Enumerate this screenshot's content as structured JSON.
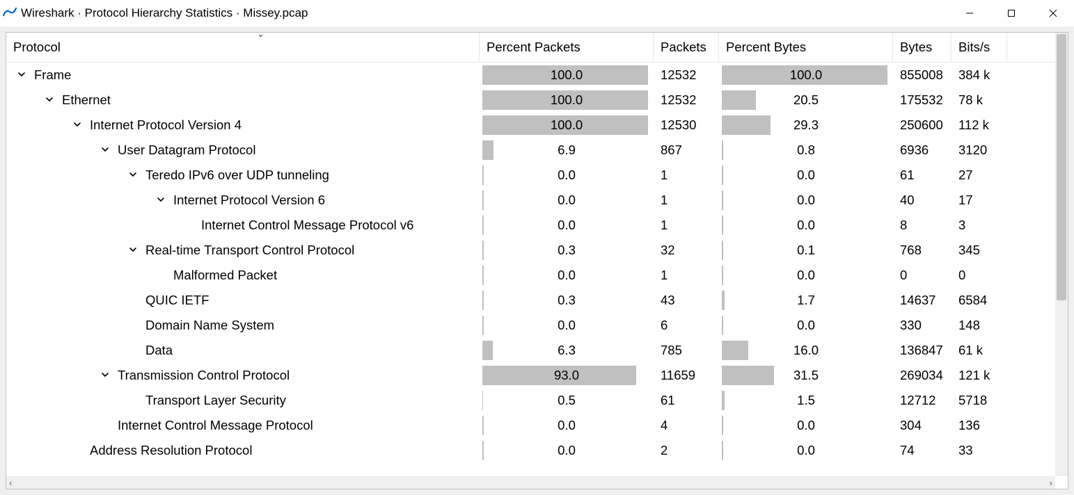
{
  "window": {
    "title": "Wireshark · Protocol Hierarchy Statistics · Missey.pcap"
  },
  "columns": {
    "protocol": "Protocol",
    "pct_packets": "Percent Packets",
    "packets": "Packets",
    "pct_bytes": "Percent Bytes",
    "bytes": "Bytes",
    "bits": "Bits/s"
  },
  "rows": [
    {
      "depth": 0,
      "expanded": true,
      "name": "Frame",
      "pct_packets": 100.0,
      "packets": "12532",
      "pct_bytes": 100.0,
      "bytes": "855008",
      "bits": "384 k"
    },
    {
      "depth": 1,
      "expanded": true,
      "name": "Ethernet",
      "pct_packets": 100.0,
      "packets": "12532",
      "pct_bytes": 20.5,
      "bytes": "175532",
      "bits": "78 k"
    },
    {
      "depth": 2,
      "expanded": true,
      "name": "Internet Protocol Version 4",
      "pct_packets": 100.0,
      "packets": "12530",
      "pct_bytes": 29.3,
      "bytes": "250600",
      "bits": "112 k"
    },
    {
      "depth": 3,
      "expanded": true,
      "name": "User Datagram Protocol",
      "pct_packets": 6.9,
      "packets": "867",
      "pct_bytes": 0.8,
      "bytes": "6936",
      "bits": "3120"
    },
    {
      "depth": 4,
      "expanded": true,
      "name": "Teredo IPv6 over UDP tunneling",
      "pct_packets": 0.0,
      "packets": "1",
      "pct_bytes": 0.0,
      "bytes": "61",
      "bits": "27"
    },
    {
      "depth": 5,
      "expanded": true,
      "name": "Internet Protocol Version 6",
      "pct_packets": 0.0,
      "packets": "1",
      "pct_bytes": 0.0,
      "bytes": "40",
      "bits": "17"
    },
    {
      "depth": 6,
      "expanded": null,
      "name": "Internet Control Message Protocol v6",
      "pct_packets": 0.0,
      "packets": "1",
      "pct_bytes": 0.0,
      "bytes": "8",
      "bits": "3"
    },
    {
      "depth": 4,
      "expanded": true,
      "name": "Real-time Transport Control Protocol",
      "pct_packets": 0.3,
      "packets": "32",
      "pct_bytes": 0.1,
      "bytes": "768",
      "bits": "345"
    },
    {
      "depth": 5,
      "expanded": null,
      "name": "Malformed Packet",
      "pct_packets": 0.0,
      "packets": "1",
      "pct_bytes": 0.0,
      "bytes": "0",
      "bits": "0"
    },
    {
      "depth": 4,
      "expanded": null,
      "name": "QUIC IETF",
      "pct_packets": 0.3,
      "packets": "43",
      "pct_bytes": 1.7,
      "bytes": "14637",
      "bits": "6584"
    },
    {
      "depth": 4,
      "expanded": null,
      "name": "Domain Name System",
      "pct_packets": 0.0,
      "packets": "6",
      "pct_bytes": 0.0,
      "bytes": "330",
      "bits": "148"
    },
    {
      "depth": 4,
      "expanded": null,
      "name": "Data",
      "pct_packets": 6.3,
      "packets": "785",
      "pct_bytes": 16.0,
      "bytes": "136847",
      "bits": "61 k"
    },
    {
      "depth": 3,
      "expanded": true,
      "name": "Transmission Control Protocol",
      "pct_packets": 93.0,
      "packets": "11659",
      "pct_bytes": 31.5,
      "bytes": "269034",
      "bits": "121 k"
    },
    {
      "depth": 4,
      "expanded": null,
      "name": "Transport Layer Security",
      "pct_packets": 0.5,
      "packets": "61",
      "pct_bytes": 1.5,
      "bytes": "12712",
      "bits": "5718"
    },
    {
      "depth": 3,
      "expanded": null,
      "name": "Internet Control Message Protocol",
      "pct_packets": 0.0,
      "packets": "4",
      "pct_bytes": 0.0,
      "bytes": "304",
      "bits": "136"
    },
    {
      "depth": 2,
      "expanded": null,
      "name": "Address Resolution Protocol",
      "pct_packets": 0.0,
      "packets": "2",
      "pct_bytes": 0.0,
      "bytes": "74",
      "bits": "33"
    }
  ]
}
